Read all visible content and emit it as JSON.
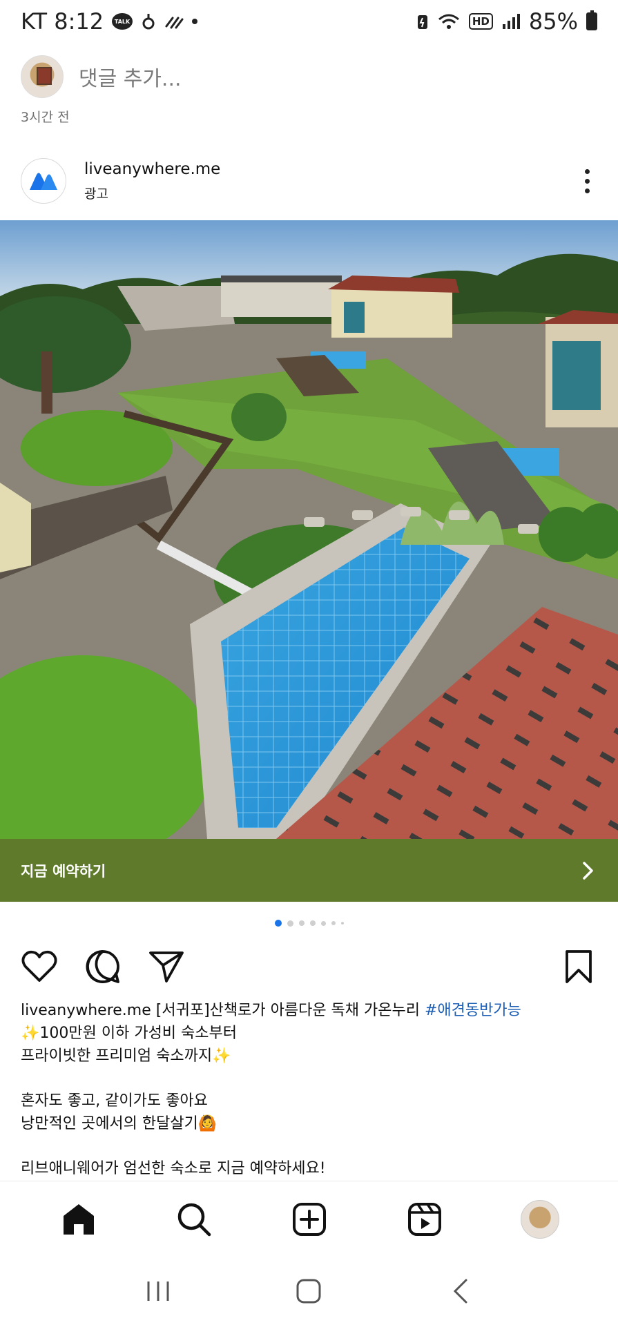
{
  "status_bar": {
    "carrier_time": "KT 8:12",
    "talk_badge": "TALK",
    "battery": "85%",
    "hd_badge": "HD"
  },
  "comment": {
    "placeholder": "댓글 추가...",
    "time_ago": "3시간 전"
  },
  "post": {
    "username": "liveanywhere.me",
    "sponsored_label": "광고",
    "brand_color": "#1a73e8",
    "cta_label": "지금 예약하기",
    "cta_color": "#5f7a2b",
    "carousel": {
      "total": 7,
      "active_index": 0
    }
  },
  "caption": {
    "username": "liveanywhere.me",
    "title": "[서귀포]산책로가 아름다운 독채 가온누리",
    "hashtag": "#애견동반가능",
    "lines": [
      "✨100만원 이하 가성비 숙소부터",
      "프라이빗한 프리미엄 숙소까지✨",
      "",
      "혼자도 좋고, 같이가도 좋아요",
      "낭만적인 곳에서의 한달살기🙆",
      "",
      "리브애니웨어가 엄선한 숙소로 지금 예약하세요!"
    ]
  },
  "nav": {
    "items": [
      "home-icon",
      "search-icon",
      "create-icon",
      "reels-icon",
      "profile-avatar"
    ]
  },
  "system_nav": {
    "items": [
      "recents-icon",
      "home-button-icon",
      "back-icon"
    ]
  }
}
